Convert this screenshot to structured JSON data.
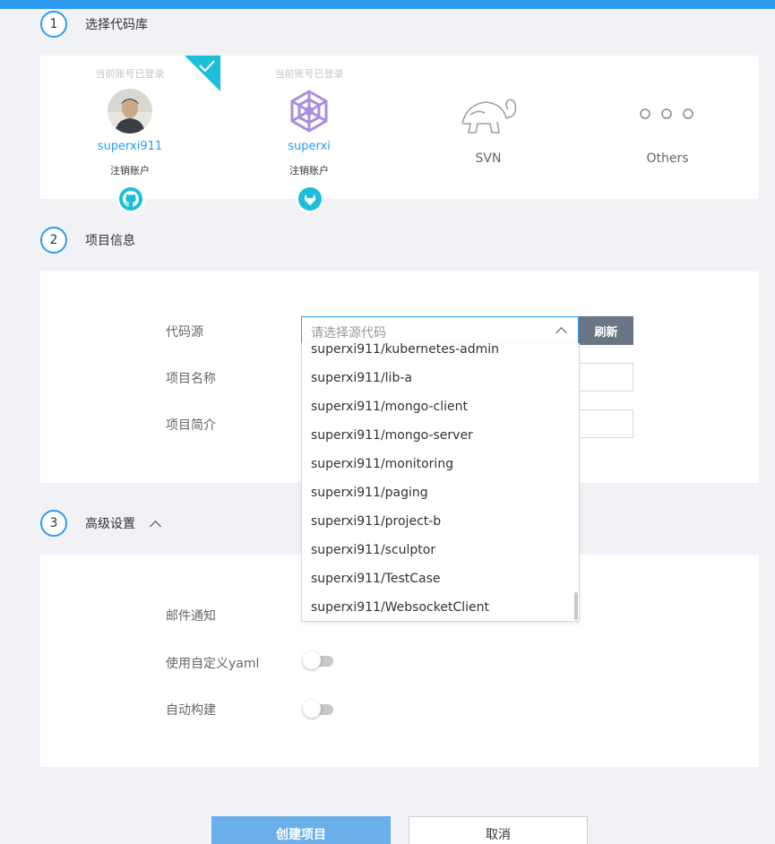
{
  "steps": [
    {
      "num": "1",
      "title": "选择代码库"
    },
    {
      "num": "2",
      "title": "项目信息"
    },
    {
      "num": "3",
      "title": "高级设置"
    }
  ],
  "repos": [
    {
      "logged": "当前账号已登录",
      "name": "superxi911",
      "action": "注销账户",
      "badge": "github-icon"
    },
    {
      "logged": "当前账号已登录",
      "name": "superxi",
      "action": "注销账户",
      "badge": "gitlab-icon"
    },
    {
      "label": "SVN",
      "icon": "svn-turtle-icon"
    },
    {
      "label": "Others",
      "icon": "more-dots-icon"
    }
  ],
  "form": {
    "source_label": "代码源",
    "source_placeholder": "请选择源代码",
    "refresh_label": "刷新",
    "name_label": "项目名称",
    "desc_label": "项目简介"
  },
  "dropdown_items": [
    "superxi911/kubernetes-admin",
    "superxi911/lib-a",
    "superxi911/mongo-client",
    "superxi911/mongo-server",
    "superxi911/monitoring",
    "superxi911/paging",
    "superxi911/project-b",
    "superxi911/sculptor",
    "superxi911/TestCase",
    "superxi911/WebsocketClient"
  ],
  "advanced": {
    "email_label": "邮件通知",
    "yaml_label": "使用自定义yaml",
    "autobuild_label": "自动构建"
  },
  "actions": {
    "create_label": "创建项目",
    "cancel_label": "取消"
  },
  "colors": {
    "accent": "#2d9bf0",
    "badge": "#1cbfd9",
    "refresh_button": "#6b7685",
    "create_button": "#6aaeea"
  }
}
